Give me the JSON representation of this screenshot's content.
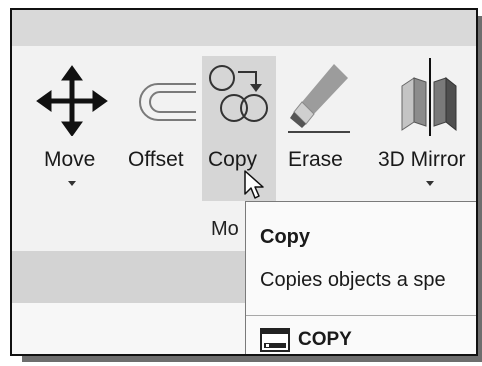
{
  "ribbon": {
    "tools": [
      {
        "id": "move",
        "label": "Move",
        "icon": "move-arrows-icon",
        "has_dropdown": true
      },
      {
        "id": "offset",
        "label": "Offset",
        "icon": "offset-icon",
        "has_dropdown": false
      },
      {
        "id": "copy",
        "label": "Copy",
        "icon": "copy-circles-icon",
        "has_dropdown": false,
        "hovered": true
      },
      {
        "id": "erase",
        "label": "Erase",
        "icon": "eraser-icon",
        "has_dropdown": false
      },
      {
        "id": "mirror3d",
        "label": "3D Mirror",
        "icon": "3d-mirror-icon",
        "has_dropdown": true
      }
    ],
    "panel_title": "Mo"
  },
  "tooltip": {
    "title": "Copy",
    "description": "Copies objects a spe",
    "command": "COPY",
    "command_icon": "command-line-icon"
  },
  "colors": {
    "title_bar": "#d9d9d9",
    "ribbon_bg": "#f2f2f2",
    "hover_bg": "#d6d6d6",
    "panel_strip": "#d3d3d3",
    "tooltip_bg": "#fafafa"
  }
}
